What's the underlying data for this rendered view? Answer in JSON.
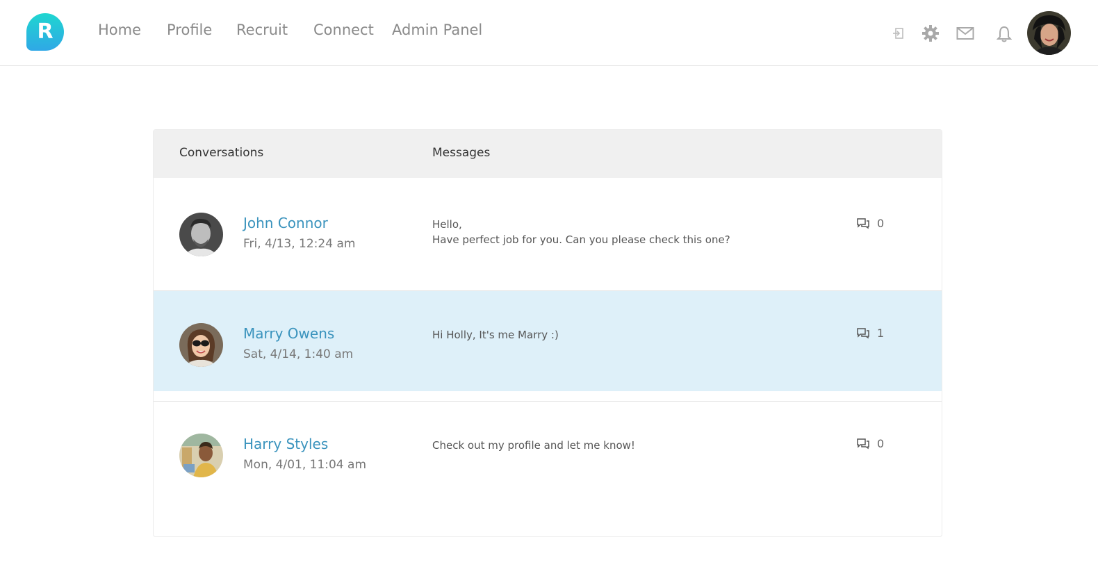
{
  "brand": {
    "logo_letter": "R",
    "gradient": [
      "#1fd6d0",
      "#2fa8e6"
    ]
  },
  "nav": {
    "home": "Home",
    "profile": "Profile",
    "recruit": "Recruit",
    "connect": "Connect",
    "admin": "Admin Panel"
  },
  "header_icons": [
    "sign-in-icon",
    "gear-icon",
    "mail-icon",
    "bell-icon"
  ],
  "panel": {
    "col_conversations": "Conversations",
    "col_messages": "Messages"
  },
  "conversations": [
    {
      "name": "John Connor",
      "date": "Fri, 4/13, 12:24 am",
      "message_line1": "Hello,",
      "message_line2": "Have perfect job for you. Can you please check this one?",
      "count": "0",
      "selected": false
    },
    {
      "name": "Marry Owens",
      "date": "Sat, 4/14, 1:40 am",
      "message_line1": "Hi Holly, It's me Marry :)",
      "count": "1",
      "selected": true
    },
    {
      "name": "Harry Styles",
      "date": "Mon, 4/01, 11:04 am",
      "message_line1": "Check out my profile and let me know!",
      "count": "0",
      "selected": false
    }
  ],
  "colors": {
    "accent": "#3a93bd",
    "selected_row": "#def0f9",
    "header_bg": "#f0f0f0"
  }
}
